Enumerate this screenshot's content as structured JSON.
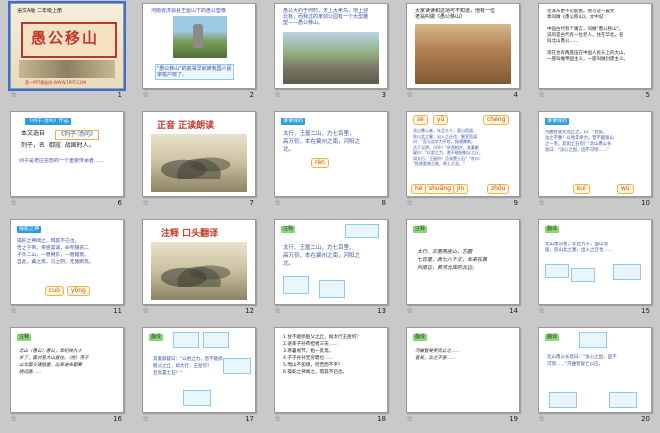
{
  "slides": [
    {
      "num": "1",
      "star": "☆",
      "badge": "语文A版 二年级上册",
      "title": "愚公移山",
      "footer": "第一PPT模板网-WWW.1PPT.COM"
    },
    {
      "num": "2",
      "star": "☆",
      "top": "河南省济源县王屋山下的愚公塑像",
      "bottom": "\"愚公移山\"的故事早就被我国人民\n家喻户晓了。"
    },
    {
      "num": "3",
      "star": "☆",
      "top": "愚公大约于何时，天上大卖鸟，地上迎\n北有，而我过的家前公园有一个大型雕\n塑——愚公移山。"
    },
    {
      "num": "4",
      "star": "☆",
      "top": "大家读读和这场可不知道，他有一位\n老翁叫做《愚公移山》"
    },
    {
      "num": "5",
      "star": "☆",
      "body": "毛泽东更不可能爸。他写过一篇文\n章叫做《愚公移山》。文中说：\n\n中国古代有个寓言，叫做\"愚公移山\"。\n说的是古代有一位老人，住在华北，名\n叫北山愚公……\n\n现在也有两座压在中国人民头上的大山，\n一座叫做帝国主义，一座叫做封建主义。"
    },
    {
      "num": "6",
      "star": "☆",
      "hdr": "《列子·汤问》作品",
      "a": "本文选自",
      "b": "《列子·汤问》",
      "c": "列子，名  御寇  战国时人。",
      "d": "列子是老庄思想的一个重要传承者......"
    },
    {
      "num": "7",
      "star": "☆",
      "title": "正音  正读朗读"
    },
    {
      "num": "8",
      "star": "☆",
      "hdr": "读读我的",
      "body": "太行、王屋二山，方七百里，\n高万仞，本在冀州之南，河阳之\n北。",
      "bubble": "rèn"
    },
    {
      "num": "9",
      "star": "☆",
      "bubbles": [
        "sè",
        "yū",
        "chéng",
        "hé",
        "shuāng",
        "jīn",
        "zhōu",
        "shì",
        "zhòu",
        "jīng"
      ],
      "body": "北山愚公者，年且九十，面山而居。\n惩山北之塞，出入之迂也，聚室而谋\n曰：\"吾与汝毕力平险，指通豫南，\n达于汉阴，可乎？\"杂然相许。其妻献\n疑曰：\"以君之力，曾不能损魁父之丘，\n如太行、王屋何？且焉置土石？\"杂曰：\n\"投诸渤海之尾，隐土之北。\""
    },
    {
      "num": "10",
      "star": "☆",
      "hdr": "读读我的",
      "body": "河曲智叟笑而止之，曰：\"甚矣，\n汝之不惠！以残年余力，曾不能毁山\n之一毛，其如土石何？\"北山愚公长\n息曰：\"汝心之固，固不可彻……\"",
      "bubbles": [
        "kuì",
        "wú"
      ]
    },
    {
      "num": "11",
      "star": "☆",
      "hdr": "操蛇之神",
      "body": "操蛇之神闻之，惧其不已也，\n告之于帝。帝感其诚，命夸娥氏二\n子负二山，一厝朔东，一厝雍南。\n自此，冀之南，汉之阴，无陇断焉。",
      "bubbles": [
        "cuò",
        "yōng"
      ]
    },
    {
      "num": "12",
      "star": "☆",
      "title": "注释  口头翻译"
    },
    {
      "num": "13",
      "star": "☆",
      "hdr": "注释",
      "body": "太行、王屋二山，方七百里，\n高万仞，本在冀州之南，河阳之\n北。"
    },
    {
      "num": "14",
      "star": "☆",
      "hdr": "注释",
      "body": "太行、王屋两座山，方圆\n七百里，高七八千丈，本来在冀\n州南边，黄河北岸的北边。"
    },
    {
      "num": "15",
      "star": "☆",
      "hdr": "翻译",
      "body": "北山愚公者，年且九十，面山而\n居。惩山北之塞，出入之迂也……"
    },
    {
      "num": "16",
      "star": "☆",
      "hdr": "注释",
      "body": "北山（愚公）愚公，年纪快九十\n岁了，面对着大山居住。（他）苦于\n山北面交通阻塞，出来进去都要\n绕远路……"
    },
    {
      "num": "17",
      "star": "☆",
      "hdr": "翻译",
      "body": "其妻献疑曰：\"以君之力，曾不能损\n魁父之丘，如太行、王屋何？\n且焉置土石？\""
    },
    {
      "num": "18",
      "star": "☆",
      "body": "1.甘不能损魁父之丘，如太行王屋何？\n2.遂率子孙荷担者三夫……\n3.寒暑易节，始一反焉。\n4.子子孙孙无穷匮也……\n5.而山不加增，何苦而不平？\n6.操蛇之神闻之，惧其不已也。"
    },
    {
      "num": "19",
      "star": "☆",
      "hdr": "翻译",
      "body": "河曲智叟笑而止之……\n甚矣，汝之不惠……"
    },
    {
      "num": "20",
      "star": "☆",
      "hdr": "翻译",
      "body": "北山愚公长息曰：\"汝心之固，固不\n可彻……\"河曲智叟亡以应。"
    }
  ]
}
